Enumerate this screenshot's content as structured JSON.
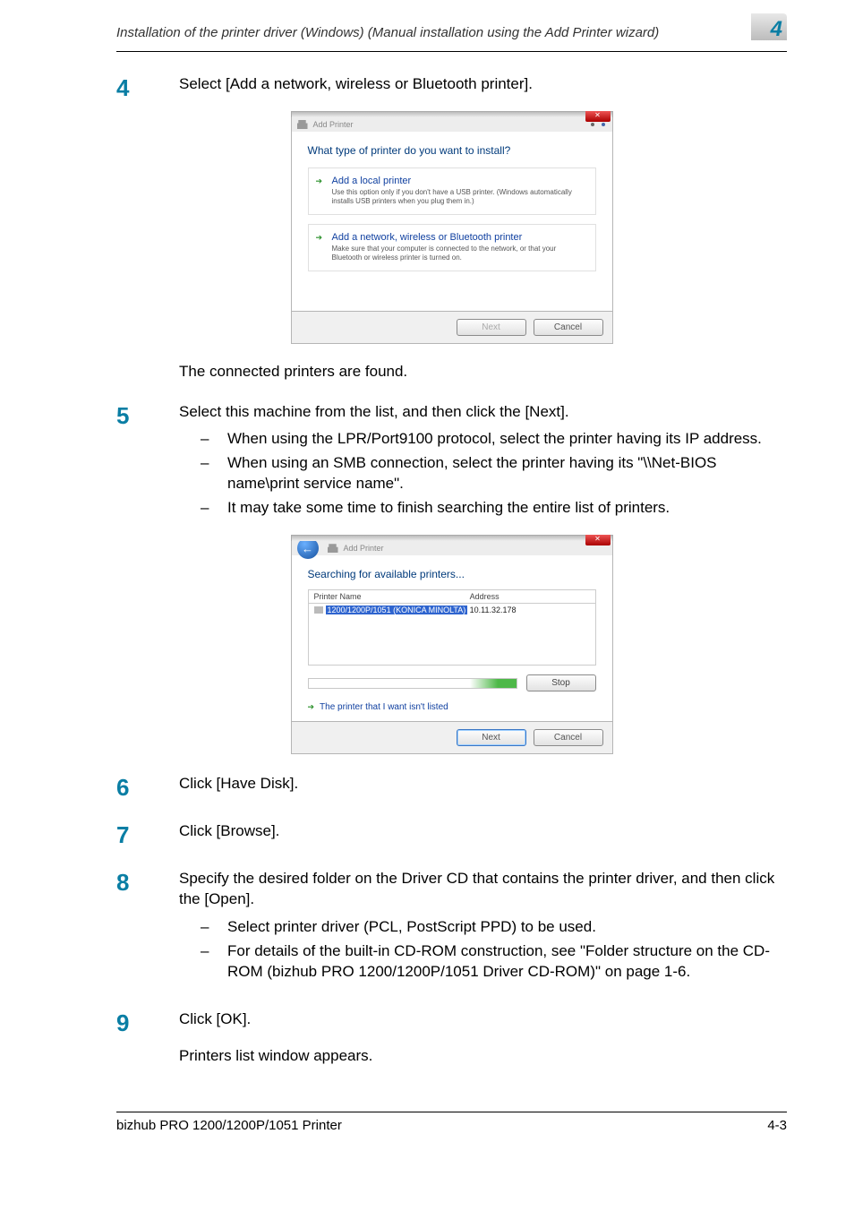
{
  "header": {
    "title": "Installation of the printer driver (Windows) (Manual installation using the Add Printer wizard)",
    "chapter_number": "4"
  },
  "steps": {
    "s4": {
      "num": "4",
      "text": "Select [Add a network, wireless or Bluetooth printer].",
      "result": "The connected printers are found."
    },
    "s5": {
      "num": "5",
      "text": "Select this machine from the list, and then click the [Next].",
      "bullet1": "When using the LPR/Port9100 protocol, select the printer having its IP address.",
      "bullet2": "When using an SMB connection, select the printer having its \"\\\\Net-BIOS name\\print service name\".",
      "bullet3": "It may take some time to finish searching the entire list of printers."
    },
    "s6": {
      "num": "6",
      "text": "Click [Have Disk]."
    },
    "s7": {
      "num": "7",
      "text": "Click [Browse]."
    },
    "s8": {
      "num": "8",
      "text": "Specify the desired folder on the Driver CD that contains the printer driver, and then click the [Open].",
      "bullet1": "Select printer driver (PCL, PostScript PPD) to be used.",
      "bullet2": "For details of the built-in CD-ROM construction, see \"Folder structure on the CD-ROM (bizhub PRO 1200/1200P/1051 Driver CD-ROM)\" on page 1-6."
    },
    "s9": {
      "num": "9",
      "text": "Click [OK].",
      "result": "Printers list window appears."
    }
  },
  "dialog1": {
    "breadcrumb": "Add Printer",
    "heading": "What type of printer do you want to install?",
    "opt1_title": "Add a local printer",
    "opt1_desc": "Use this option only if you don't have a USB printer. (Windows automatically installs USB printers when you plug them in.)",
    "opt2_title": "Add a network, wireless or Bluetooth printer",
    "opt2_desc": "Make sure that your computer is connected to the network, or that your Bluetooth or wireless printer is turned on.",
    "next": "Next",
    "cancel": "Cancel"
  },
  "dialog2": {
    "breadcrumb": "Add Printer",
    "heading": "Searching for available printers...",
    "col1": "Printer Name",
    "col2": "Address",
    "row1_name": "1200/1200P/1051 (KONICA MINOLTA)",
    "row1_addr": "10.11.32.178",
    "stop": "Stop",
    "notlisted": "The printer that I want isn't listed",
    "next": "Next",
    "cancel": "Cancel"
  },
  "footer": {
    "left": "bizhub PRO 1200/1200P/1051 Printer",
    "right": "4-3"
  }
}
